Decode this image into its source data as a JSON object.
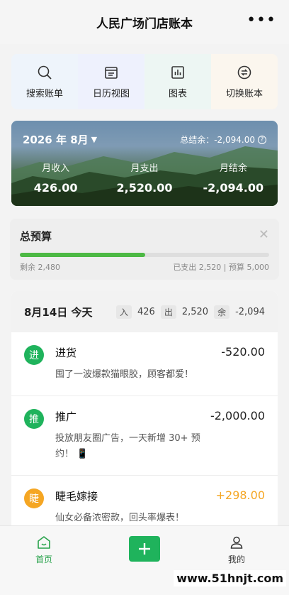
{
  "header": {
    "title": "人民广场门店账本",
    "more_icon": "more-icon"
  },
  "quick_actions": [
    {
      "label": "搜索账单",
      "icon": "search-icon"
    },
    {
      "label": "日历视图",
      "icon": "calendar-icon"
    },
    {
      "label": "图表",
      "icon": "chart-icon"
    },
    {
      "label": "切换账本",
      "icon": "switch-icon"
    }
  ],
  "summary": {
    "month": "2026 年 8月",
    "total_label": "总结余：-2,094.00",
    "income_label": "月收入",
    "income_value": "426.00",
    "expense_label": "月支出",
    "expense_value": "2,520.00",
    "balance_label": "月结余",
    "balance_value": "-2,094.00"
  },
  "budget": {
    "title": "总预算",
    "remaining": "剩余 2,480",
    "spent_info": "已支出 2,520 | 预算 5,000",
    "progress_percent": 50.4
  },
  "day": {
    "date": "8月14日 今天",
    "in_label": "入",
    "in_value": "426",
    "out_label": "出",
    "out_value": "2,520",
    "bal_label": "余",
    "bal_value": "-2,094",
    "records": [
      {
        "icon_char": "进",
        "color": "#1fb35c",
        "name": "进货",
        "amount": "-520.00",
        "amount_color": "#222222",
        "note": "囤了一波爆款猫眼胶，顾客都爱！"
      },
      {
        "icon_char": "推",
        "color": "#1fb35c",
        "name": "推广",
        "amount": "-2,000.00",
        "amount_color": "#222222",
        "note": "投放朋友圈广告，一天新增 30+ 预约！ 📱"
      },
      {
        "icon_char": "睫",
        "color": "#f5a623",
        "name": "睫毛嫁接",
        "amount": "+298.00",
        "amount_color": "#f5a623",
        "note": "仙女必备浓密款，回头率爆表！"
      }
    ]
  },
  "tabbar": {
    "home_label": "首页",
    "mine_label": "我的"
  },
  "watermark": "www.51hnjt.com"
}
